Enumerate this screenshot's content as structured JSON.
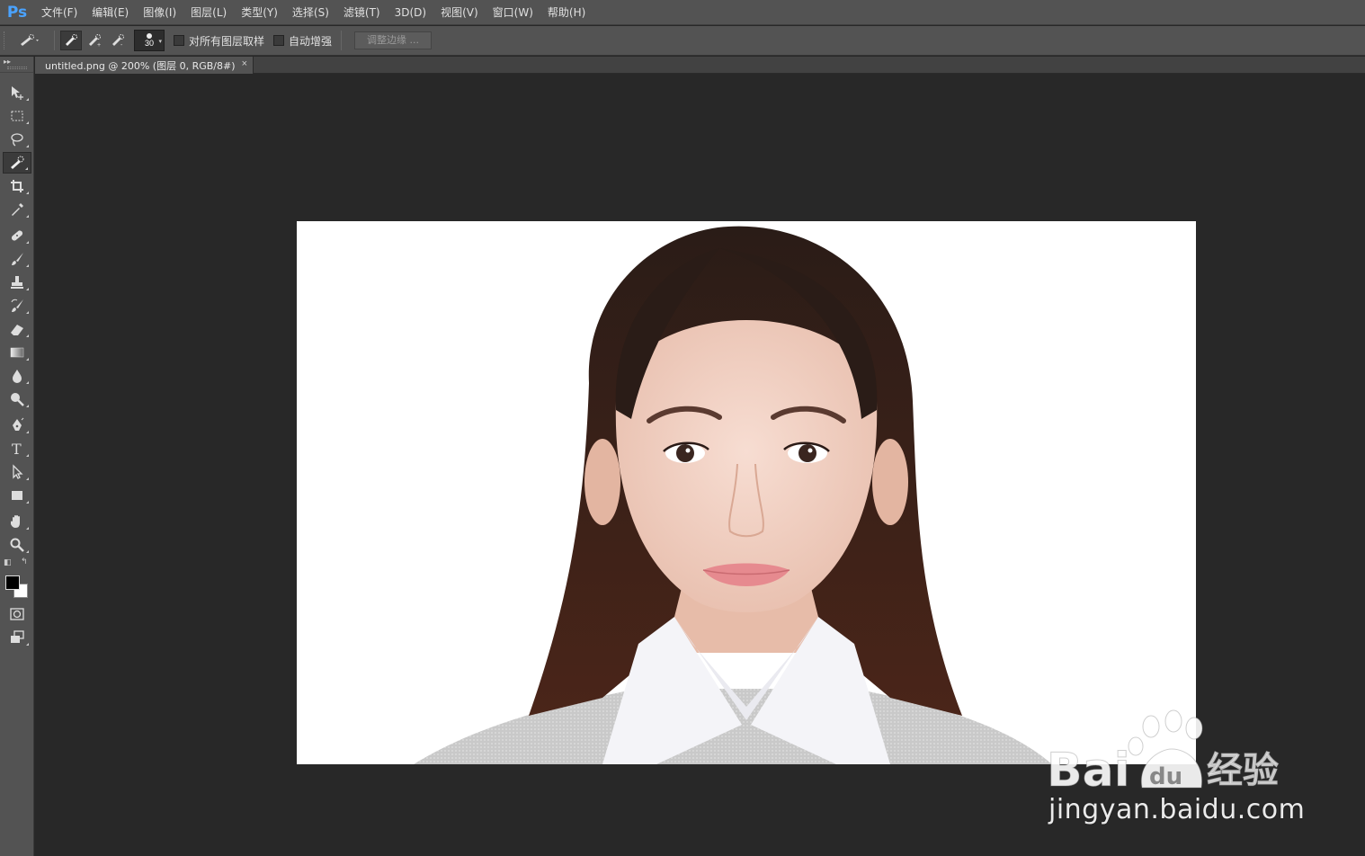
{
  "app": {
    "logo": "Ps"
  },
  "menu": {
    "items": [
      "文件(F)",
      "编辑(E)",
      "图像(I)",
      "图层(L)",
      "类型(Y)",
      "选择(S)",
      "滤镜(T)",
      "3D(D)",
      "视图(V)",
      "窗口(W)",
      "帮助(H)"
    ]
  },
  "options": {
    "brush_size": "30",
    "sample_all_layers_label": "对所有图层取样",
    "sample_all_layers_checked": false,
    "auto_enhance_label": "自动增强",
    "auto_enhance_checked": false,
    "refine_edge_label": "调整边缘 ..."
  },
  "document": {
    "tab_label": "untitled.png @ 200% (图层 0, RGB/8#)",
    "close_glyph": "×"
  },
  "tools": [
    "move-tool",
    "marquee-tool",
    "lasso-tool",
    "quick-selection-tool",
    "crop-tool",
    "eyedropper-tool",
    "healing-brush-tool",
    "brush-tool",
    "clone-stamp-tool",
    "history-brush-tool",
    "eraser-tool",
    "gradient-tool",
    "blur-tool",
    "dodge-tool",
    "pen-tool",
    "type-tool",
    "path-selection-tool",
    "rectangle-tool",
    "hand-tool",
    "zoom-tool",
    "quick-mask-tool",
    "screen-mode-tool"
  ],
  "active_tool": "quick-selection-tool",
  "colors": {
    "foreground": "#000000",
    "background": "#ffffff"
  },
  "watermark": {
    "brand": "Bai du 经验",
    "url": "jingyan.baidu.com"
  }
}
